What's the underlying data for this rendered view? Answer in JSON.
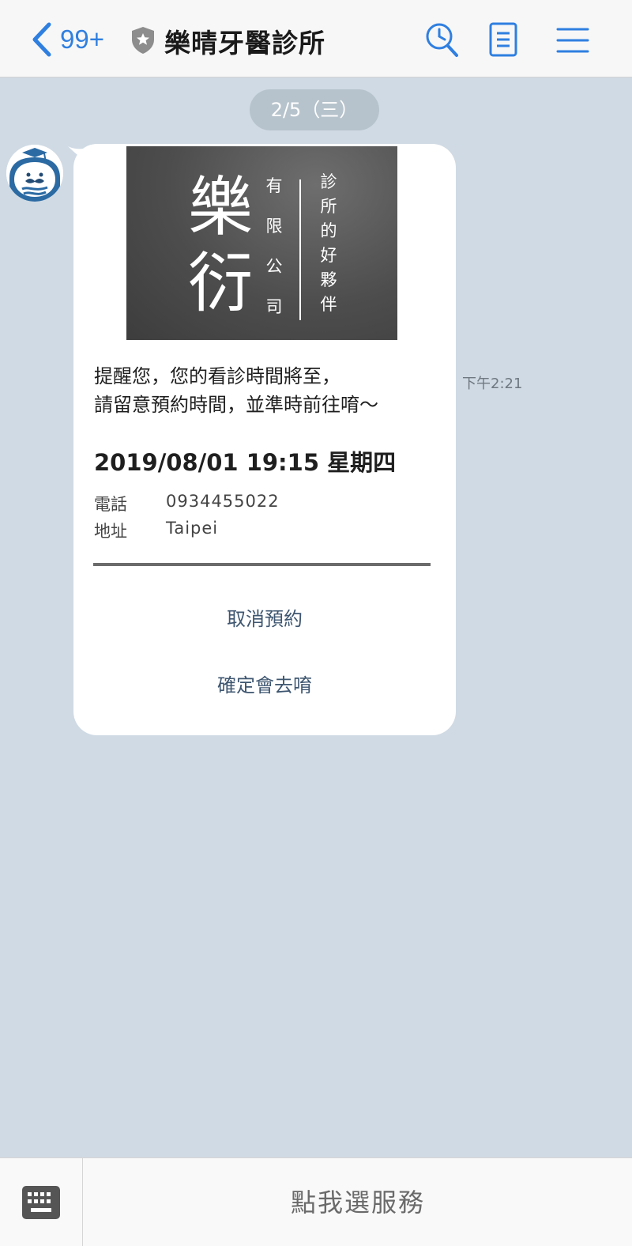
{
  "header": {
    "back_count": "99+",
    "title": "樂晴牙醫診所",
    "icons": [
      "chevron-left-icon",
      "shield-star-icon",
      "search-clock-icon",
      "notes-icon",
      "menu-icon"
    ]
  },
  "chat": {
    "date_label": "2/5（三）",
    "message": {
      "banner": {
        "logo_char1": "樂",
        "logo_char2": "衍",
        "company_chars": [
          "有",
          "限",
          "公",
          "司"
        ],
        "slogan_chars": [
          "診",
          "所",
          "的",
          "好",
          "夥",
          "伴"
        ]
      },
      "line1": "提醒您，您的看診時間將至，",
      "line2": "請留意預約時間，並準時前往唷～",
      "datetime": "2019/08/01 19:15 星期四",
      "phone_label": "電話",
      "phone_value": "0934455022",
      "address_label": "地址",
      "address_value": "Taipei",
      "cancel_label": "取消預約",
      "confirm_label": "確定會去唷"
    },
    "timestamp": "下午2:21"
  },
  "bottom": {
    "service_label": "點我選服務",
    "keyboard_icon": "keyboard-icon"
  },
  "colors": {
    "accent": "#2f7fe0",
    "chat_bg": "#cfdae4",
    "action_text": "#3e5670"
  }
}
